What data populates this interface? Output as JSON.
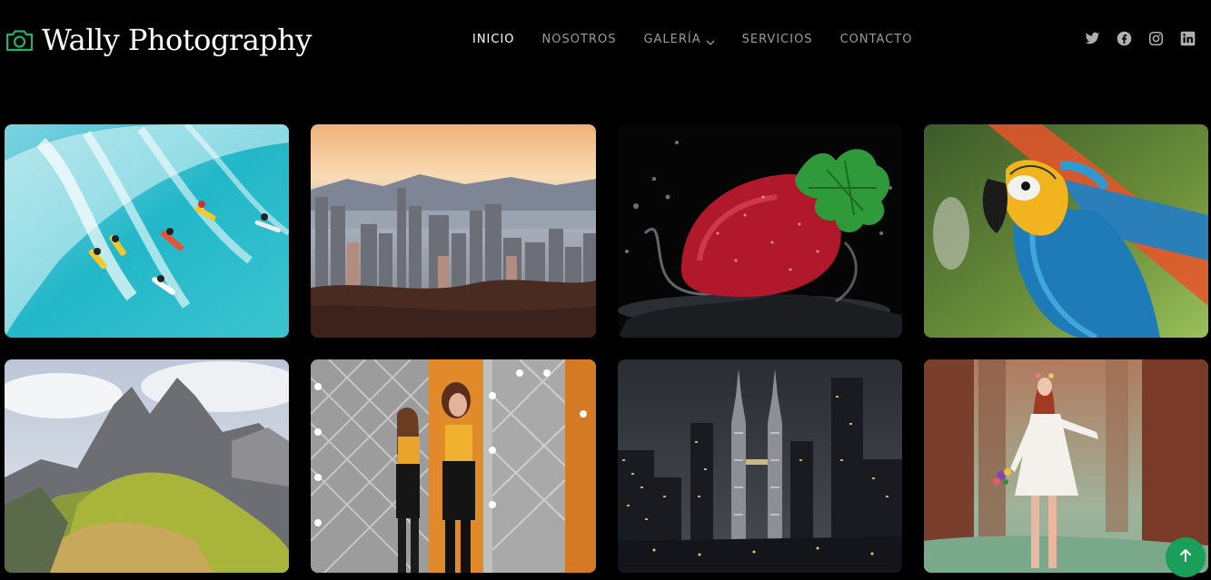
{
  "brand": {
    "name": "Wally Photography",
    "icon": "camera-icon",
    "accent": "#1db46a"
  },
  "nav": {
    "items": [
      {
        "label": "INICIO",
        "active": true
      },
      {
        "label": "NOSOTROS",
        "active": false
      },
      {
        "label": "GALERÍA",
        "active": false,
        "dropdown": true
      },
      {
        "label": "SERVICIOS",
        "active": false
      },
      {
        "label": "CONTACTO",
        "active": false
      }
    ]
  },
  "social": [
    "twitter-icon",
    "facebook-icon",
    "instagram-icon",
    "linkedin-icon"
  ],
  "gallery": [
    {
      "subject": "surfers riding a turquoise wave"
    },
    {
      "subject": "city skyline at sunset"
    },
    {
      "subject": "strawberry splashing in water"
    },
    {
      "subject": "blue and yellow macaw parrot"
    },
    {
      "subject": "mountain peaks with green slopes"
    },
    {
      "subject": "woman posing between mirrors"
    },
    {
      "subject": "illuminated city towers at night"
    },
    {
      "subject": "woman in white dress in forest"
    }
  ],
  "back_to_top": {
    "icon": "arrow-up-icon",
    "color": "#1a9e5a"
  }
}
